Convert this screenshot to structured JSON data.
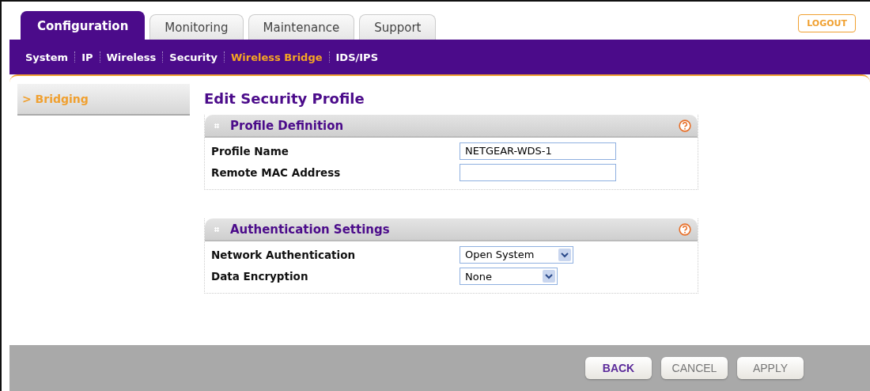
{
  "tabs": [
    {
      "label": "Configuration",
      "selected": true
    },
    {
      "label": "Monitoring",
      "selected": false
    },
    {
      "label": "Maintenance",
      "selected": false
    },
    {
      "label": "Support",
      "selected": false
    }
  ],
  "logout": "LOGOUT",
  "subnav": [
    {
      "label": "System",
      "selected": false
    },
    {
      "label": "IP",
      "selected": false
    },
    {
      "label": "Wireless",
      "selected": false
    },
    {
      "label": "Security",
      "selected": false
    },
    {
      "label": "Wireless Bridge",
      "selected": true
    },
    {
      "label": "IDS/IPS",
      "selected": false
    }
  ],
  "sidebar": {
    "items": [
      {
        "marker": ">",
        "label": "Bridging",
        "selected": true
      }
    ]
  },
  "page_title": "Edit Security Profile",
  "sections": [
    {
      "title": "Profile Definition",
      "fields": [
        {
          "kind": "text",
          "label": "Profile Name",
          "value": "NETGEAR-WDS-1"
        },
        {
          "kind": "text",
          "label": "Remote MAC Address"
        }
      ]
    },
    {
      "title": "Authentication Settings",
      "fields": [
        {
          "kind": "select",
          "label": "Network Authentication",
          "value": "Open System"
        },
        {
          "kind": "select",
          "label": "Data Encryption",
          "value": "None"
        }
      ]
    }
  ],
  "buttons": [
    {
      "label": "BACK",
      "disabled": false
    },
    {
      "label": "CANCEL",
      "disabled": true
    },
    {
      "label": "APPLY",
      "disabled": true
    }
  ]
}
